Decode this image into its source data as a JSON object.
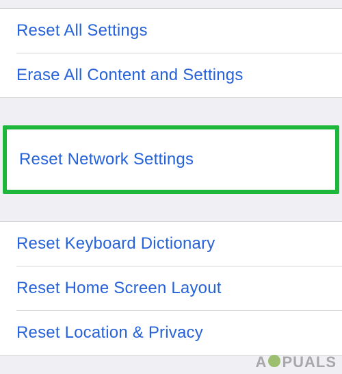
{
  "reset_menu": {
    "group1": [
      {
        "label": "Reset All Settings"
      },
      {
        "label": "Erase All Content and Settings"
      }
    ],
    "highlighted": {
      "label": "Reset Network Settings"
    },
    "group2": [
      {
        "label": "Reset Keyboard Dictionary"
      },
      {
        "label": "Reset Home Screen Layout"
      },
      {
        "label": "Reset Location & Privacy"
      }
    ]
  },
  "watermark": {
    "prefix": "A",
    "suffix": "PUALS"
  }
}
